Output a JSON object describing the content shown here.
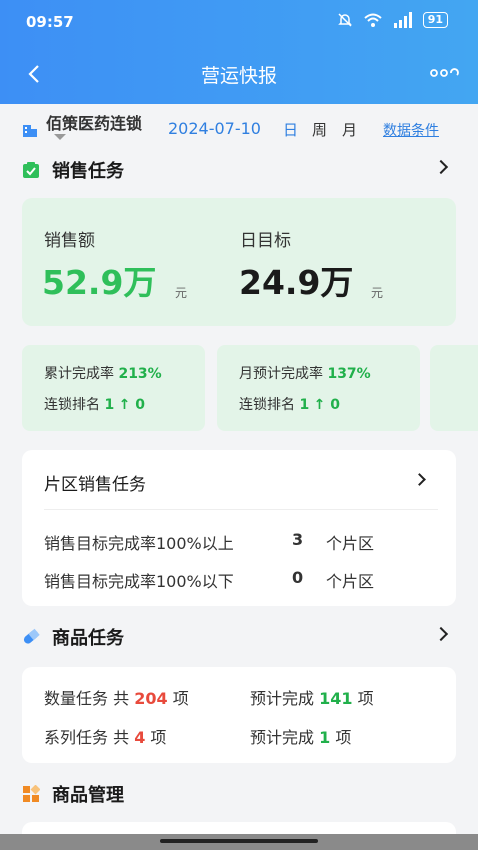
{
  "status_bar": {
    "time": "09:57",
    "battery": "91"
  },
  "nav": {
    "title": "营运快报"
  },
  "filter": {
    "store": "佰策医药连锁",
    "date": "2024-07-10",
    "periods": [
      "日",
      "周",
      "月"
    ],
    "data_conditions": "数据条件"
  },
  "sales_task": {
    "title": "销售任务",
    "sales_label": "销售额",
    "sales_value": "52.9万",
    "sales_unit": "元",
    "target_label": "日目标",
    "target_value": "24.9万",
    "target_unit": "元",
    "cards": [
      {
        "rate_label": "累计完成率",
        "rate_value": "213%",
        "rank_label": "连锁排名",
        "rank_value": "1",
        "rank_change": "↑ 0"
      },
      {
        "rate_label": "月预计完成率",
        "rate_value": "137%",
        "rank_label": "连锁排名",
        "rank_value": "1",
        "rank_change": "↑ 0"
      }
    ]
  },
  "region_task": {
    "title": "片区销售任务",
    "above_label": "销售目标完成率100%以上",
    "above_count": "3",
    "below_label": "销售目标完成率100%以下",
    "below_count": "0",
    "unit": "个片区"
  },
  "product_task": {
    "title": "商品任务",
    "qty_label": "数量任务 共",
    "qty_total": "204",
    "qty_unit": "项",
    "qty_expected_label": "预计完成",
    "qty_expected": "141",
    "qty_expected_unit": "项",
    "series_label": "系列任务 共",
    "series_total": "4",
    "series_unit": "项",
    "series_expected_label": "预计完成",
    "series_expected": "1",
    "series_expected_unit": "项"
  },
  "product_mgmt": {
    "title": "商品管理"
  },
  "colors": {
    "header": "#3d8ff5",
    "accent_blue": "#2f7fe0",
    "green": "#21b04b",
    "red": "#e84a3c",
    "card_green": "#e3f4e8"
  },
  "icons": [
    "back-arrow-icon",
    "more-icon",
    "building-icon",
    "sales-task-icon",
    "pill-icon",
    "grid-icon"
  ]
}
